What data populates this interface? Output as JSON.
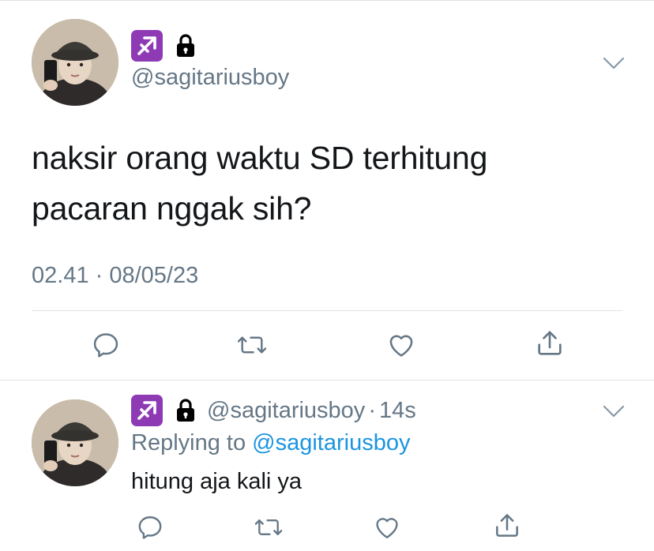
{
  "main_tweet": {
    "handle": "@sagitariusboy",
    "text_line1": "naksir orang waktu SD terhitung",
    "text_line2": "pacaran nggak sih?",
    "timestamp": "02.41 · 08/05/23",
    "actions": [
      "reply-icon",
      "retweet-icon",
      "like-icon",
      "share-icon"
    ]
  },
  "reply_tweet": {
    "handle": "@sagitariusboy",
    "separator": "·",
    "time_ago": "14s",
    "replying_prefix": "Replying to",
    "replying_to": "@sagitariusboy",
    "text": "hitung aja kali ya",
    "actions": [
      "reply-icon",
      "retweet-icon",
      "like-icon",
      "share-icon"
    ]
  },
  "colors": {
    "text_primary": "#14171a",
    "text_secondary": "#657786",
    "link": "#1b95e0",
    "badge_purple": "#8e3ab5",
    "divider": "#dfe3e6"
  },
  "icons": {
    "zodiac_badge": "sagittarius-icon",
    "protected": "lock-icon",
    "menu": "chevron-down-icon"
  }
}
